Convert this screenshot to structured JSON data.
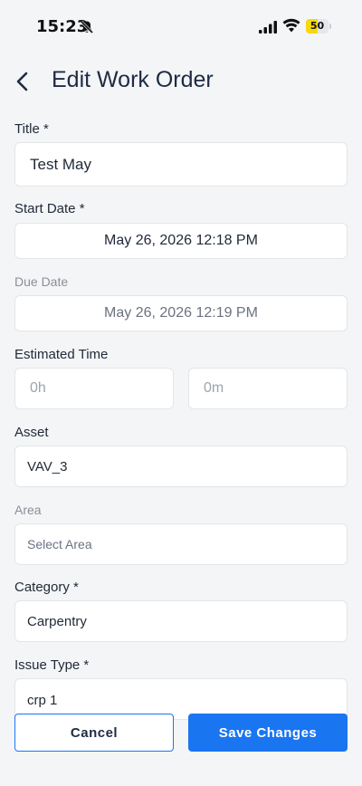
{
  "status_bar": {
    "time": "15:23",
    "battery_level": "50",
    "battery_fraction": 0.5,
    "icons": [
      "bell-slash-icon",
      "signal-icon",
      "wifi-icon",
      "battery-icon"
    ]
  },
  "header": {
    "title": "Edit Work Order",
    "back_icon": "chevron-left-icon"
  },
  "form": {
    "title": {
      "label": "Title *",
      "value": "Test May"
    },
    "start_date": {
      "label": "Start Date *",
      "value": "May 26, 2026 12:18 PM"
    },
    "due_date": {
      "label": "Due Date",
      "value": "May 26, 2026 12:19 PM"
    },
    "estimated_time": {
      "label": "Estimated Time",
      "hours_placeholder": "0h",
      "minutes_placeholder": "0m"
    },
    "asset": {
      "label": "Asset",
      "value": "VAV_3"
    },
    "area": {
      "label": "Area",
      "placeholder": "Select Area"
    },
    "category": {
      "label": "Category *",
      "value": "Carpentry"
    },
    "issue_type": {
      "label": "Issue Type *",
      "value": "crp 1"
    }
  },
  "actions": {
    "cancel_label": "Cancel",
    "save_label": "Save Changes"
  },
  "colors": {
    "primary": "#1a75f0",
    "background": "#f4f5f7",
    "battery": "#f5d90a"
  }
}
